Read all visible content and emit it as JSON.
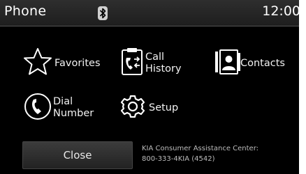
{
  "header": {
    "title": "Phone",
    "clock": "12:00",
    "bluetooth_icon": "bluetooth-icon"
  },
  "menu": {
    "favorites": {
      "label": "Favorites",
      "icon": "star-icon"
    },
    "call_history": {
      "label_line1": "Call",
      "label_line2": "History",
      "icon": "call-history-icon"
    },
    "contacts": {
      "label": "Contacts",
      "icon": "contacts-icon"
    },
    "dial_number": {
      "label_line1": "Dial",
      "label_line2": "Number",
      "icon": "dial-phone-icon"
    },
    "setup": {
      "label": "Setup",
      "icon": "gear-icon"
    }
  },
  "footer": {
    "close_label": "Close",
    "assistance_line1": "KIA Consumer Assistance Center:",
    "assistance_line2": "800-333-4KIA (4542)"
  }
}
